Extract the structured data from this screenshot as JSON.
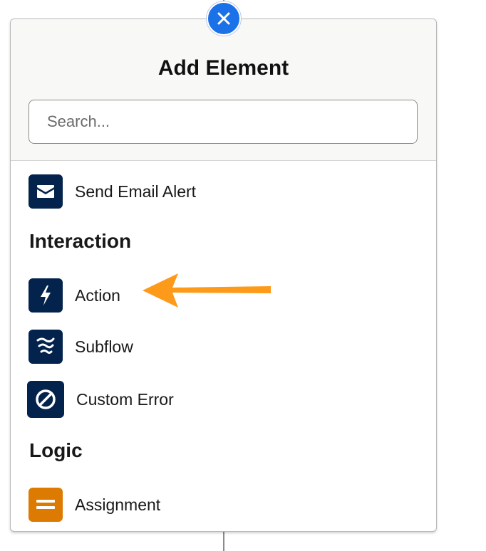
{
  "panel": {
    "title": "Add Element",
    "search": {
      "placeholder": "Search...",
      "value": ""
    }
  },
  "items": [
    {
      "label": "Send Email Alert",
      "icon": "envelope-icon"
    },
    {
      "label": "Action",
      "icon": "lightning-bolt-icon"
    },
    {
      "label": "Subflow",
      "icon": "subflow-icon"
    },
    {
      "label": "Custom Error",
      "icon": "prohibited-icon"
    },
    {
      "label": "Assignment",
      "icon": "equals-icon"
    }
  ],
  "sections": [
    {
      "heading": "Interaction"
    },
    {
      "heading": "Logic"
    }
  ],
  "annotation": {
    "icon": "orange-arrow-icon",
    "points_to": "Action"
  },
  "colors": {
    "close_button": "#1b71e8",
    "icon_navy": "#03234d",
    "icon_orange": "#dd7a01",
    "arrow": "#fe9a19"
  }
}
